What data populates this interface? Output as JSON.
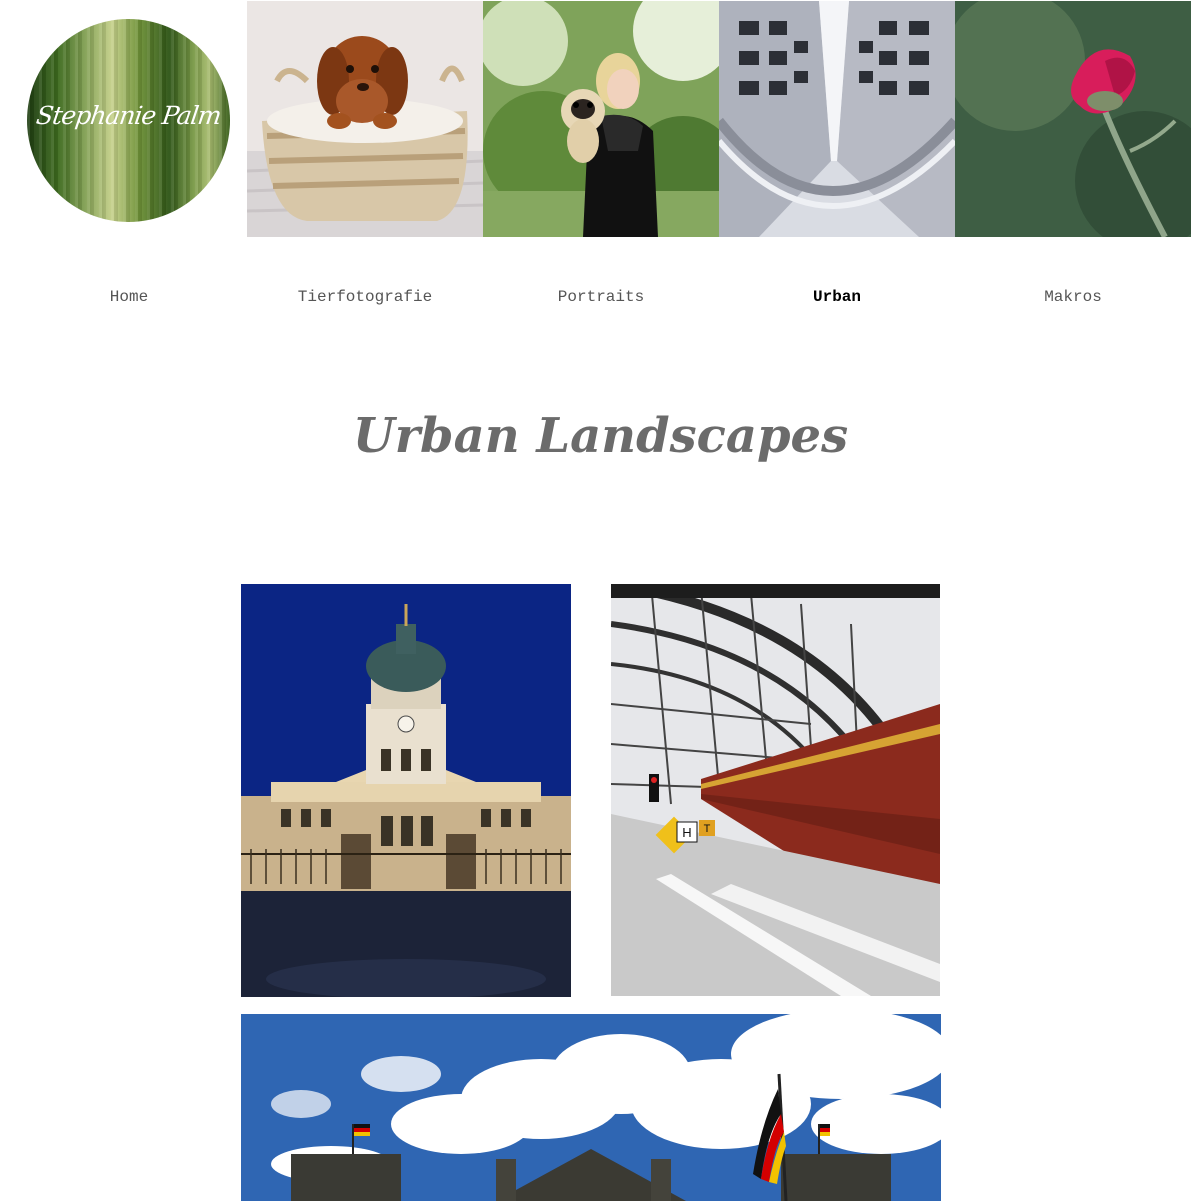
{
  "logo": {
    "signature": "Stephanie Palm"
  },
  "header_tiles": [
    {
      "name": "dachshund-puppy-basket"
    },
    {
      "name": "woman-with-pug"
    },
    {
      "name": "urban-architecture"
    },
    {
      "name": "pink-flower-macro"
    }
  ],
  "nav": {
    "items": [
      {
        "label": "Home"
      },
      {
        "label": "Tierfotografie"
      },
      {
        "label": "Portraits"
      },
      {
        "label": "Urban"
      },
      {
        "label": "Makros"
      }
    ],
    "active": "Urban"
  },
  "page": {
    "title": "Urban Landscapes"
  },
  "colors": {
    "nav_text": "#555555",
    "nav_active": "#000000",
    "title": "#6b6b6b"
  }
}
